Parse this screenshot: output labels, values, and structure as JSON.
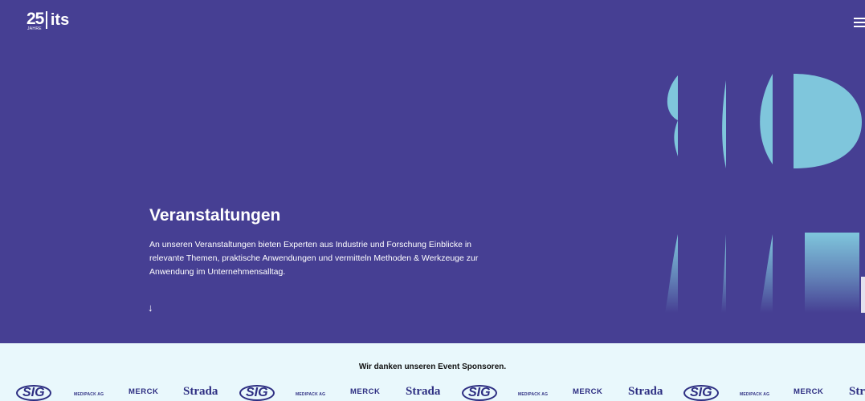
{
  "header": {
    "logo_number": "25",
    "logo_sub": "JAHRE",
    "logo_name": "its"
  },
  "hero": {
    "title": "Veranstaltungen",
    "text": "An unseren Veranstaltungen bieten Experten aus Industrie und Forschung Einblicke in relevante Themen, praktische Anwendungen und vermitteln Methoden & Werkzeuge zur Anwendung im Unternehmensalltag.",
    "arrow": "↓",
    "background_color": "#463f93",
    "shape_color": "#7fc6dc"
  },
  "sponsors": {
    "heading": "Wir danken unseren Event Sponsoren.",
    "logos": [
      "SIG",
      "MEDIPACK AG",
      "MERCK",
      "Strada",
      "SIG",
      "MEDIPACK AG",
      "MERCK",
      "Strada",
      "SIG",
      "MEDIPACK AG",
      "MERCK",
      "Strada",
      "SIG",
      "MEDIPACK AG",
      "MERCK",
      "Str"
    ],
    "background_color": "#e9f8fc"
  },
  "icons": {
    "menu": "hamburger-menu-icon",
    "scroll": "arrow-down-icon"
  }
}
